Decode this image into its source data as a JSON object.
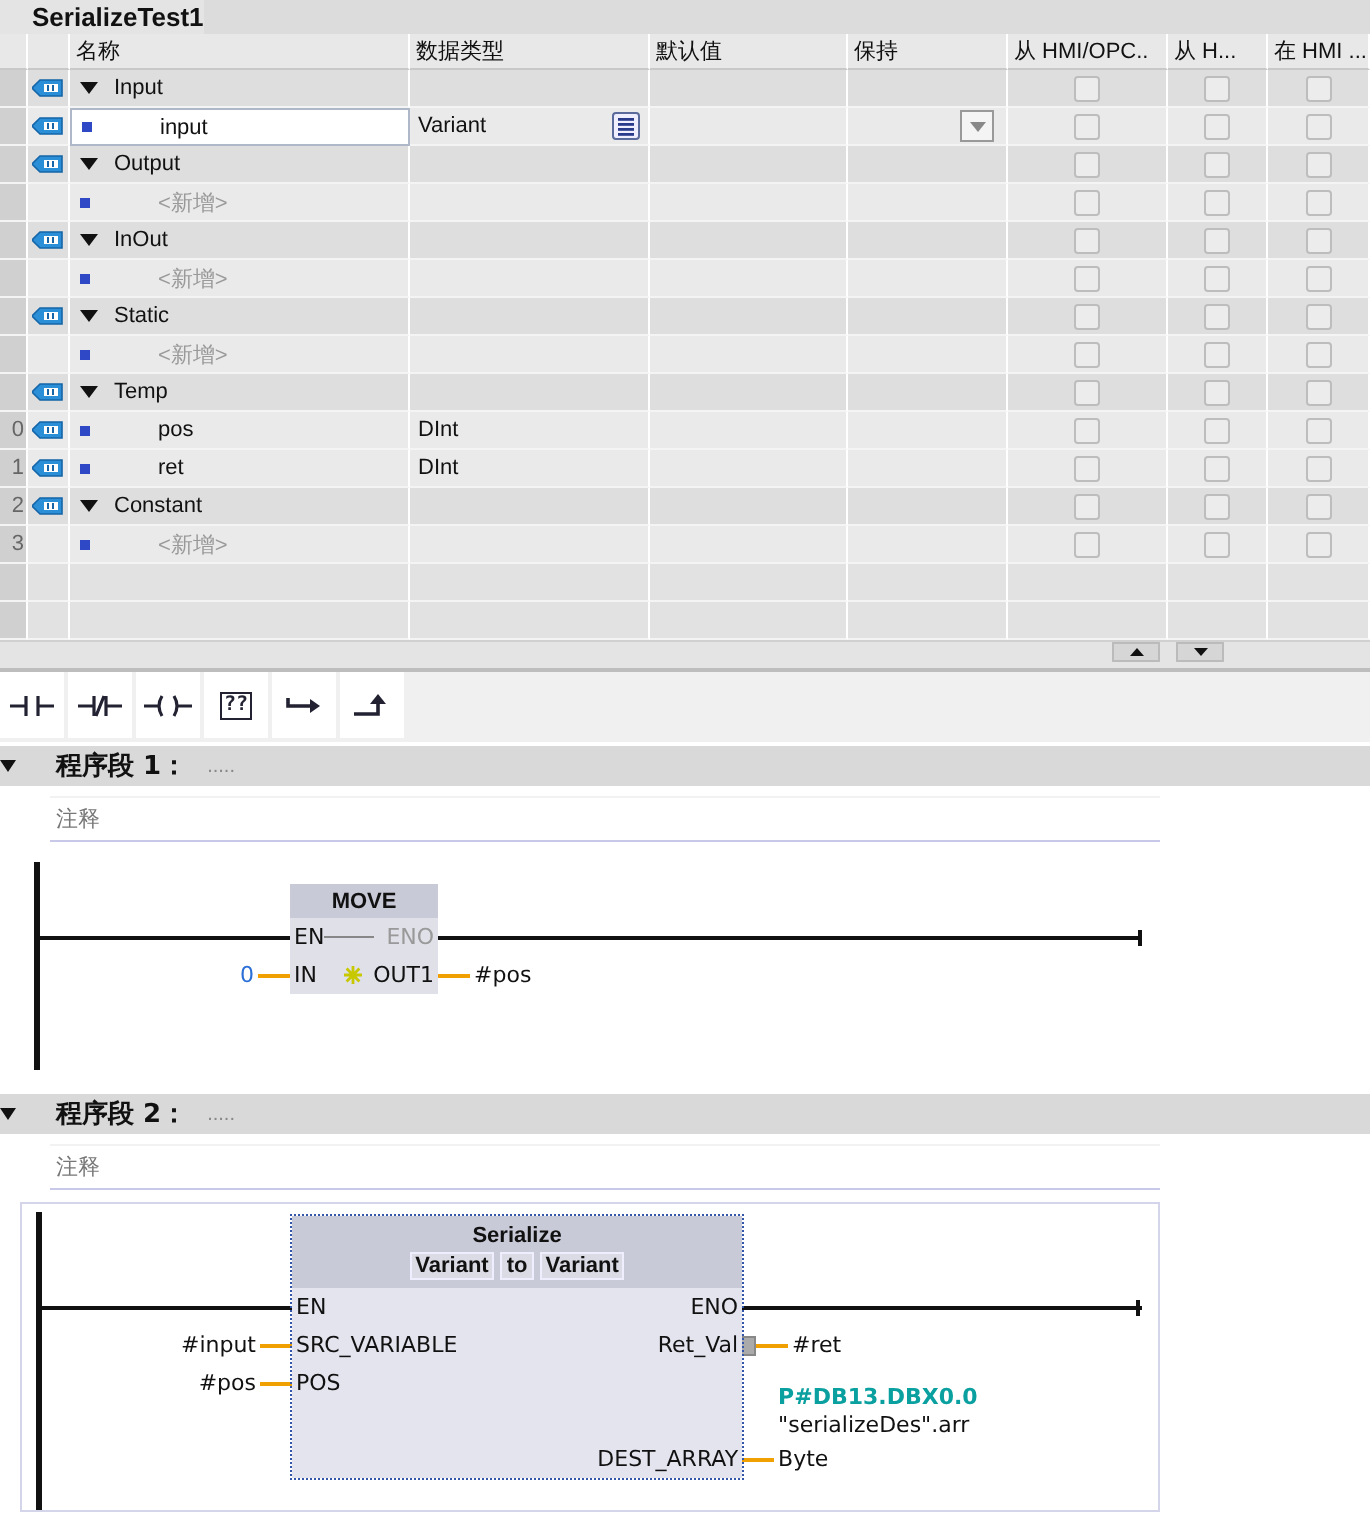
{
  "block": {
    "title": "SerializeTest1"
  },
  "interface_table": {
    "columns": [
      "名称",
      "数据类型",
      "默认值",
      "保持",
      "从 HMI/OPC..",
      "从 H...",
      "在 HMI ..."
    ],
    "rows": [
      {
        "kind": "section",
        "icon": true,
        "expanded": true,
        "name": "Input",
        "selected": false,
        "checks": [
          false,
          false,
          false
        ]
      },
      {
        "kind": "item",
        "icon": true,
        "name": "input",
        "data_type": "Variant",
        "selected": true,
        "checks": [
          false,
          false,
          false
        ]
      },
      {
        "kind": "section",
        "icon": true,
        "expanded": true,
        "name": "Output",
        "selected": false,
        "checks": [
          false,
          false,
          false
        ]
      },
      {
        "kind": "add",
        "icon": false,
        "name": "<新增>",
        "selected": false,
        "checks": [
          false,
          false,
          false
        ]
      },
      {
        "kind": "section",
        "icon": true,
        "expanded": true,
        "name": "InOut",
        "selected": false,
        "checks": [
          false,
          false,
          false
        ]
      },
      {
        "kind": "add",
        "icon": false,
        "name": "<新增>",
        "selected": false,
        "checks": [
          false,
          false,
          false
        ]
      },
      {
        "kind": "section",
        "icon": true,
        "expanded": true,
        "name": "Static",
        "selected": false,
        "checks": [
          false,
          false,
          false
        ]
      },
      {
        "kind": "add",
        "icon": false,
        "name": "<新增>",
        "selected": false,
        "checks": [
          false,
          false,
          false
        ]
      },
      {
        "kind": "section",
        "icon": true,
        "expanded": true,
        "name": "Temp",
        "selected": false,
        "checks": [
          false,
          false,
          false
        ]
      },
      {
        "kind": "item",
        "icon": true,
        "number": "0",
        "name": "pos",
        "data_type": "DInt",
        "selected": false,
        "checks": [
          false,
          false,
          false
        ]
      },
      {
        "kind": "item",
        "icon": true,
        "number": "1",
        "name": "ret",
        "data_type": "DInt",
        "selected": false,
        "checks": [
          false,
          false,
          false
        ]
      },
      {
        "kind": "section",
        "icon": true,
        "number": "2",
        "expanded": true,
        "name": "Constant",
        "selected": false,
        "checks": [
          false,
          false,
          false
        ]
      },
      {
        "kind": "add",
        "icon": false,
        "number": "3",
        "name": "<新增>",
        "selected": false,
        "checks": [
          false,
          false,
          false
        ]
      }
    ]
  },
  "toolbar": [
    {
      "kind": "contact-no"
    },
    {
      "kind": "contact-nc"
    },
    {
      "kind": "coil"
    },
    {
      "kind": "empty-box",
      "label": "??"
    },
    {
      "kind": "open-branch"
    },
    {
      "kind": "close-branch"
    }
  ],
  "networks": [
    {
      "title": "程序段 1：",
      "dots": ".....",
      "expanded": true,
      "comment": "注释",
      "selected_box": false,
      "box": {
        "name": "MOVE",
        "inputs": [
          {
            "pin": "EN"
          },
          {
            "pin": "IN",
            "operand": "0",
            "kind": "constant"
          }
        ],
        "outputs": [
          {
            "pin": "ENO",
            "disabled": true
          },
          {
            "pin": "OUT1",
            "operand": "#pos",
            "marker": true
          }
        ]
      }
    },
    {
      "title": "程序段 2：",
      "dots": ".....",
      "expanded": true,
      "comment": "注释",
      "selected_box": true,
      "box": {
        "name": "Serialize",
        "types": [
          "Variant",
          "to",
          "Variant"
        ],
        "inputs": [
          {
            "pin": "EN"
          },
          {
            "pin": "SRC_VARIABLE",
            "operand": "#input"
          },
          {
            "pin": "POS",
            "operand": "#pos"
          }
        ],
        "outputs": [
          {
            "pin": "ENO"
          },
          {
            "pin": "Ret_Val",
            "operand": "#ret",
            "connector": true
          },
          {
            "pin": "DEST_ARRAY",
            "operand": "Byte",
            "address": "P#DB13.DBX0.0",
            "symbol": "\"serializeDes\".arr"
          }
        ]
      }
    }
  ]
}
